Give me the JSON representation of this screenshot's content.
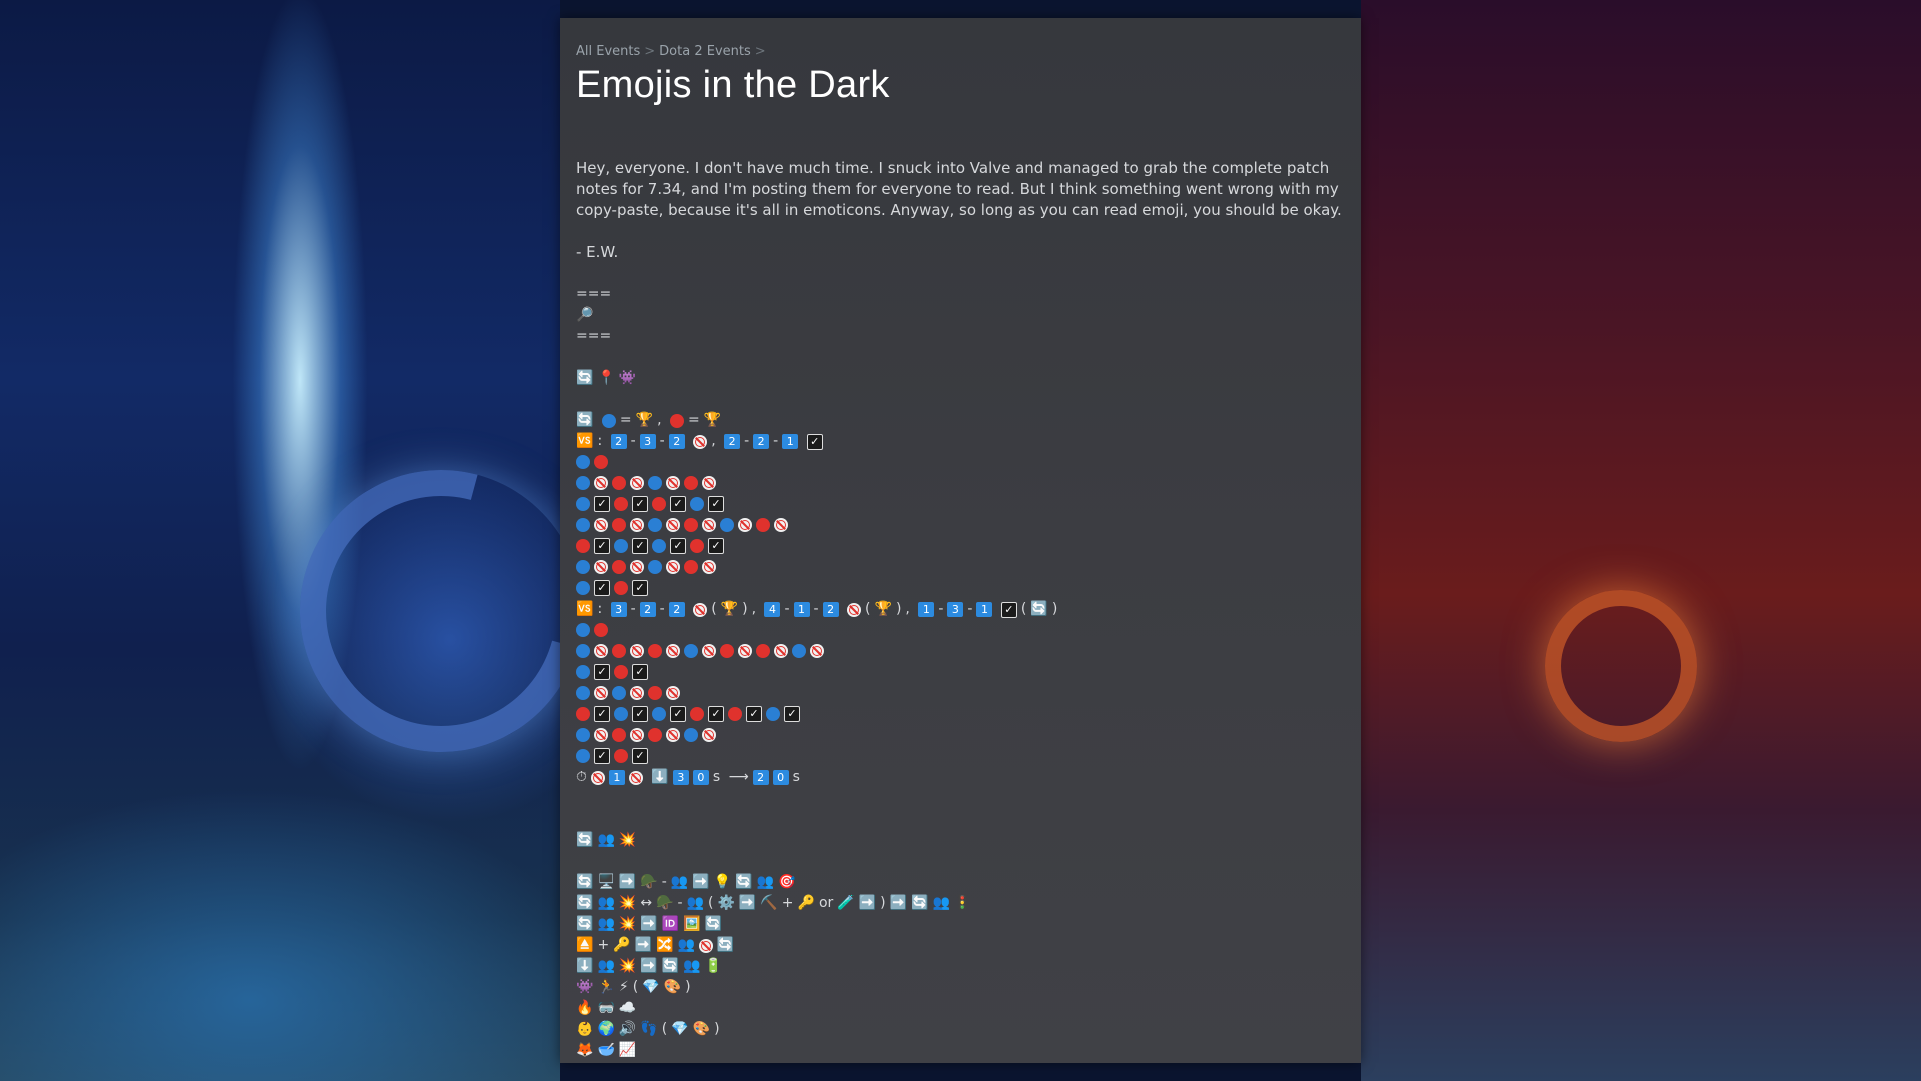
{
  "breadcrumbs": [
    "All Events",
    "Dota 2 Events"
  ],
  "title": "Emojis in the Dark",
  "intro": "Hey, everyone. I don't have much time. I snuck into Valve and managed to grab the complete patch notes for 7.34, and I'm posting them for everyone to read. But I think something went wrong with my copy-paste, because it's all in emoticons. Anyway, so long as you can read emoji, you should be okay.",
  "signature": "- E.W.",
  "divider": "===",
  "icons": {
    "search": "🔎",
    "refresh": "🔄",
    "pin": "📍",
    "ghost": "👾",
    "emblem": "🆚",
    "trophy": "🏆",
    "stopwatch": "⏱",
    "down_arrow": "⬇️",
    "right_arrow": "➡️",
    "long_arrow": "⟶",
    "leftright": "↔",
    "people": "👥",
    "explosion": "💥",
    "monitor": "🖥️",
    "helmet": "🪖",
    "bulb": "💡",
    "target": "🎯",
    "gear": "⚙️",
    "pick": "⛏️",
    "key": "🔑",
    "tube": "🧪",
    "traffic": "🚦",
    "id": "🆔",
    "picture": "🖼️",
    "eject": "⏏️",
    "shuffle": "🔀",
    "battery": "🔋",
    "runner": "🏃",
    "bolt": "⚡",
    "gem": "💎",
    "palette": "🎨",
    "fire": "🔥",
    "mask": "🥽",
    "cloud": "☁️",
    "baby": "👶",
    "globe": "🌍",
    "speaker": "🔊",
    "feet": "👣",
    "fox": "🦊",
    "bowl": "🥣",
    "chart": "📈"
  },
  "text_tokens": {
    "eq": "=",
    "comma": ",",
    "colon": ":",
    "dash": "-",
    "plus": "+",
    "or": "or",
    "s": "s",
    "lparen": "(",
    "rparen": ")",
    "check": "✓"
  },
  "numbers": {
    "n2": "2",
    "n3": "3",
    "n1": "1",
    "n4": "4",
    "n0": "0"
  }
}
